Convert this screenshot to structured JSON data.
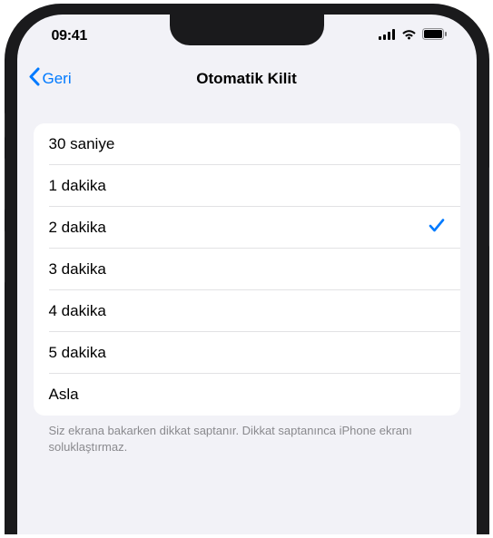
{
  "status_bar": {
    "time": "09:41"
  },
  "nav": {
    "back_label": "Geri",
    "title": "Otomatik Kilit"
  },
  "options": [
    {
      "label": "30 saniye",
      "selected": false
    },
    {
      "label": "1 dakika",
      "selected": false
    },
    {
      "label": "2 dakika",
      "selected": true
    },
    {
      "label": "3 dakika",
      "selected": false
    },
    {
      "label": "4 dakika",
      "selected": false
    },
    {
      "label": "5 dakika",
      "selected": false
    },
    {
      "label": "Asla",
      "selected": false
    }
  ],
  "footer": "Siz ekrana bakarken dikkat saptanır. Dikkat saptanınca iPhone ekranı soluklaştırmaz."
}
